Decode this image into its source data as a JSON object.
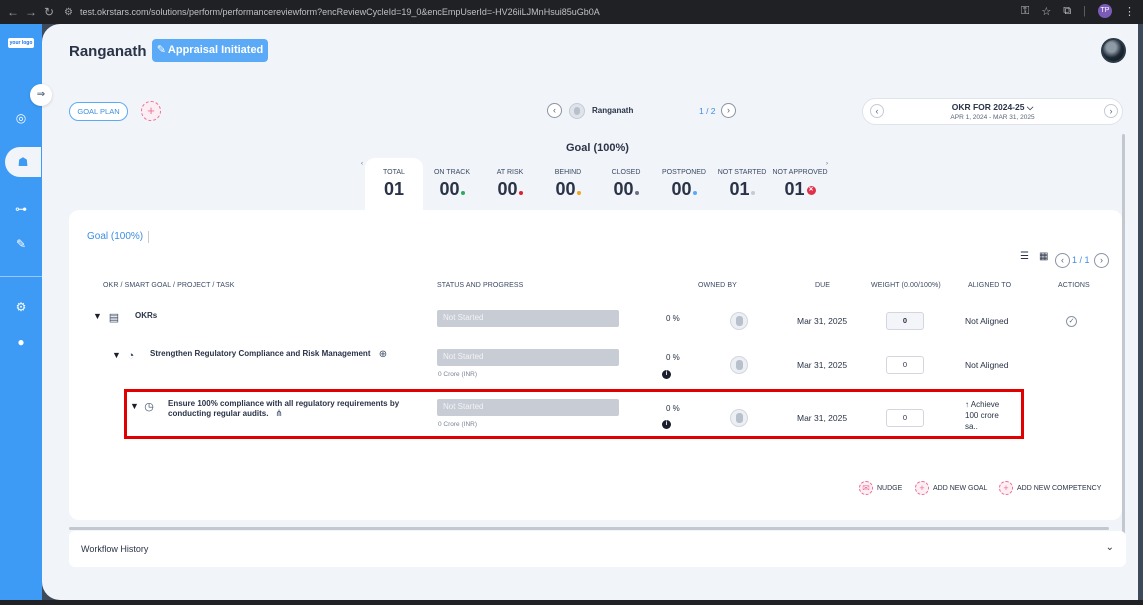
{
  "browser": {
    "url": "test.okrstars.com/solutions/perform/performancereviewform?encReviewCycleId=19_0&encEmpUserId=-HV26iiLJMnHsui85uGb0A"
  },
  "sidebar": {
    "logo_text": "your logo"
  },
  "header": {
    "employee_name": "Ranganath",
    "status_label": "Appraisal Initiated"
  },
  "toolbar": {
    "goal_plan_label": "GOAL PLAN",
    "employee_nav_name": "Ranganath",
    "employee_nav_count": "1 / 2",
    "period_title": "OKR FOR 2024-25",
    "period_dates": "APR 1, 2024 - MAR 31, 2025"
  },
  "summary": {
    "heading": "Goal (100%)",
    "stats": [
      {
        "label": "TOTAL",
        "value": "01"
      },
      {
        "label": "ON TRACK",
        "value": "00"
      },
      {
        "label": "AT RISK",
        "value": "00"
      },
      {
        "label": "BEHIND",
        "value": "00"
      },
      {
        "label": "CLOSED",
        "value": "00"
      },
      {
        "label": "POSTPONED",
        "value": "00"
      },
      {
        "label": "NOT STARTED",
        "value": "01"
      },
      {
        "label": "NOT APPROVED",
        "value": "01"
      }
    ]
  },
  "card": {
    "tab_label": "Goal (100%)",
    "pager_label": "1 / 1",
    "columns": {
      "okr": "OKR / SMART GOAL / PROJECT / TASK",
      "status": "STATUS AND PROGRESS",
      "owned_by": "OWNED BY",
      "due": "DUE",
      "weight": "WEIGHT (0.00/100%)",
      "aligned_to": "ALIGNED TO",
      "actions": "ACTIONS"
    },
    "rows": [
      {
        "title": "OKRs",
        "status": "Not Started",
        "progress": "0 %",
        "due": "Mar 31, 2025",
        "weight": "0",
        "aligned": "Not Aligned"
      },
      {
        "title": "Strengthen Regulatory Compliance and Risk Management",
        "status": "Not Started",
        "currency": "0 Crore (INR)",
        "progress": "0 %",
        "due": "Mar 31, 2025",
        "weight": "0",
        "aligned": "Not Aligned"
      },
      {
        "title_line1": "Ensure 100% compliance with all regulatory requirements by",
        "title_line2": "conducting regular audits.",
        "status": "Not Started",
        "currency": "0 Crore (INR)",
        "progress": "0 %",
        "due": "Mar 31, 2025",
        "weight": "0",
        "aligned_line1": "↑ Achieve",
        "aligned_line2": "100 crore",
        "aligned_line3": "sa.."
      }
    ],
    "actions": {
      "nudge": "NUDGE",
      "add_goal": "ADD NEW GOAL",
      "add_competency": "ADD NEW COMPETENCY"
    }
  },
  "workflow": {
    "label": "Workflow History"
  }
}
